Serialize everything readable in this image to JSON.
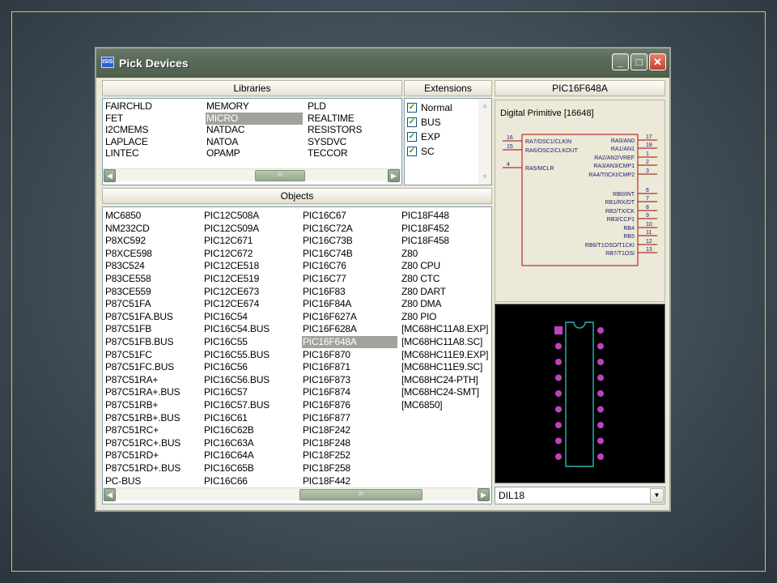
{
  "window": {
    "app_icon": "ISIS",
    "title": "Pick Devices",
    "buttons": {
      "minimize": "_",
      "maximize": "□",
      "close": "✕"
    }
  },
  "headers": {
    "libraries": "Libraries",
    "extensions": "Extensions",
    "device": "PIC16F648A",
    "objects": "Objects"
  },
  "libraries": {
    "columns": [
      [
        "FAIRCHLD",
        "FET",
        "I2CMEMS",
        "LAPLACE",
        "LINTEC"
      ],
      [
        "MEMORY",
        "MICRO",
        "NATDAC",
        "NATOA",
        "OPAMP"
      ],
      [
        "PLD",
        "REALTIME",
        "RESISTORS",
        "SYSDVC",
        "TECCOR"
      ]
    ],
    "selected": "MICRO",
    "scroll_thumb_label": "III"
  },
  "extensions": [
    {
      "label": "Normal",
      "checked": true
    },
    {
      "label": "BUS",
      "checked": true
    },
    {
      "label": "EXP",
      "checked": true
    },
    {
      "label": "SC",
      "checked": true
    }
  ],
  "objects": {
    "columns": [
      [
        "MC6850",
        "NM232CD",
        "P8XC592",
        "P8XCE598",
        "P83C524",
        "P83CE558",
        "P83CE559",
        "P87C51FA",
        "P87C51FA.BUS",
        "P87C51FB",
        "P87C51FB.BUS",
        "P87C51FC",
        "P87C51FC.BUS",
        "P87C51RA+",
        "P87C51RA+.BUS",
        "P87C51RB+",
        "P87C51RB+.BUS",
        "P87C51RC+",
        "P87C51RC+.BUS",
        "P87C51RD+",
        "P87C51RD+.BUS",
        "PC-BUS"
      ],
      [
        "PIC12C508A",
        "PIC12C509A",
        "PIC12C671",
        "PIC12C672",
        "PIC12CE518",
        "PIC12CE519",
        "PIC12CE673",
        "PIC12CE674",
        "PIC16C54",
        "PIC16C54.BUS",
        "PIC16C55",
        "PIC16C55.BUS",
        "PIC16C56",
        "PIC16C56.BUS",
        "PIC16C57",
        "PIC16C57.BUS",
        "PIC16C61",
        "PIC16C62B",
        "PIC16C63A",
        "PIC16C64A",
        "PIC16C65B",
        "PIC16C66"
      ],
      [
        "PIC16C67",
        "PIC16C72A",
        "PIC16C73B",
        "PIC16C74B",
        "PIC16C76",
        "PIC16C77",
        "PIC16F83",
        "PIC16F84A",
        "PIC16F627A",
        "PIC16F628A",
        "PIC16F648A",
        "PIC16F870",
        "PIC16F871",
        "PIC16F873",
        "PIC16F874",
        "PIC16F876",
        "PIC16F877",
        "PIC18F242",
        "PIC18F248",
        "PIC18F252",
        "PIC18F258",
        "PIC18F442"
      ],
      [
        "PIC18F448",
        "PIC18F452",
        "PIC18F458",
        "Z80",
        "Z80 CPU",
        "Z80 CTC",
        "Z80 DART",
        "Z80 DMA",
        "Z80 PIO",
        "[MC68HC11A8.EXP]",
        "[MC68HC11A8.SC]",
        "[MC68HC11E9.EXP]",
        "[MC68HC11E9.SC]",
        "[MC68HC24-PTH]",
        "[MC68HC24-SMT]",
        "[MC6850]"
      ]
    ],
    "selected": "PIC16F648A",
    "scroll_thumb_label": "III"
  },
  "schematic": {
    "primitive_label": "Digital Primitive [16648]",
    "left_pins": [
      {
        "num": "16",
        "name": "RA7/OSC1/CLKIN"
      },
      {
        "num": "15",
        "name": "RA6/OSC2/CLKOUT"
      },
      {
        "num": "4",
        "name": "RA5/MCLR"
      }
    ],
    "right_pins": [
      {
        "num": "17",
        "name": "RA0/AN0"
      },
      {
        "num": "18",
        "name": "RA1/AN1"
      },
      {
        "num": "1",
        "name": "RA2/AN2/VREF"
      },
      {
        "num": "2",
        "name": "RA3/AN3/CMP1"
      },
      {
        "num": "3",
        "name": "RA4/T0CKI/CMP2"
      },
      {
        "num": "6",
        "name": "RB0/INT"
      },
      {
        "num": "7",
        "name": "RB1/RX/DT"
      },
      {
        "num": "8",
        "name": "RB2/TX/CK"
      },
      {
        "num": "9",
        "name": "RB3/CCP1"
      },
      {
        "num": "10",
        "name": "RB4"
      },
      {
        "num": "11",
        "name": "RB5"
      },
      {
        "num": "12",
        "name": "RB6/T1OSO/T1CKI"
      },
      {
        "num": "13",
        "name": "RB7/T1OSI"
      }
    ],
    "colors": {
      "body": "#b0302a",
      "text": "#1a1a6e"
    }
  },
  "package": {
    "name": "DIL18",
    "pins_per_side": 9,
    "colors": {
      "pad": "#c040c0",
      "outline": "#2fb3b3"
    }
  }
}
